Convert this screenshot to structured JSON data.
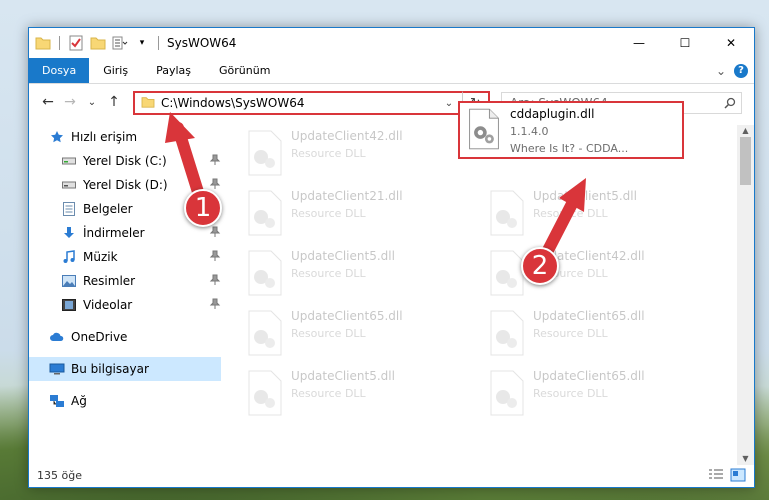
{
  "window": {
    "title": "SysWOW64",
    "controls": {
      "minimize": "—",
      "maximize": "☐",
      "close": "✕"
    }
  },
  "ribbon": {
    "tabs": [
      "Dosya",
      "Giriş",
      "Paylaş",
      "Görünüm"
    ],
    "expand": "⌄",
    "help": "?"
  },
  "nav": {
    "back": "←",
    "forward": "→",
    "recent": "⌄",
    "up": "↑",
    "address": "C:\\Windows\\SysWOW64",
    "address_dropdown": "⌄",
    "refresh": "↻",
    "search_placeholder": "Ara: SysWOW64"
  },
  "sidebar": {
    "items": [
      {
        "label": "Hızlı erişim",
        "icon": "star-icon"
      },
      {
        "label": "Yerel Disk (C:)",
        "icon": "drive-icon",
        "pinned": true
      },
      {
        "label": "Yerel Disk (D:)",
        "icon": "drive-icon",
        "pinned": true
      },
      {
        "label": "Belgeler",
        "icon": "documents-icon",
        "pinned": true
      },
      {
        "label": "İndirmeler",
        "icon": "download-icon",
        "pinned": true
      },
      {
        "label": "Müzik",
        "icon": "music-icon",
        "pinned": true
      },
      {
        "label": "Resimler",
        "icon": "pictures-icon",
        "pinned": true
      },
      {
        "label": "Videolar",
        "icon": "videos-icon",
        "pinned": true
      },
      {
        "label": "OneDrive",
        "icon": "cloud-icon"
      },
      {
        "label": "Bu bilgisayar",
        "icon": "computer-icon",
        "selected": true
      },
      {
        "label": "Ağ",
        "icon": "network-icon"
      }
    ]
  },
  "files": {
    "left_col": [
      {
        "name": "UpdateClient42.dll",
        "desc": "Resource DLL"
      },
      {
        "name": "UpdateClient21.dll",
        "desc": "Resource DLL"
      },
      {
        "name": "UpdateClient5.dll",
        "desc": "Resource DLL"
      },
      {
        "name": "UpdateClient65.dll",
        "desc": "Resource DLL"
      },
      {
        "name": "UpdateClient5.dll",
        "desc": "Resource DLL"
      }
    ],
    "right_col": [
      {
        "name": "UpdateClient5.dll",
        "desc": "Resource DLL"
      },
      {
        "name": "UpdateClient42.dll",
        "desc": "Resource DLL"
      },
      {
        "name": "UpdateClient65.dll",
        "desc": "Resource DLL"
      },
      {
        "name": "UpdateClient65.dll",
        "desc": "Resource DLL"
      }
    ],
    "highlighted": {
      "name": "cddaplugin.dll",
      "version": "1.1.4.0",
      "description": "Where Is It? - CDDA..."
    }
  },
  "status": {
    "count": "135 öğe"
  },
  "annotations": {
    "step1": "1",
    "step2": "2"
  },
  "colors": {
    "accent": "#1979ca",
    "highlight_red": "#d9353a",
    "selected_bg": "#cce8ff"
  }
}
